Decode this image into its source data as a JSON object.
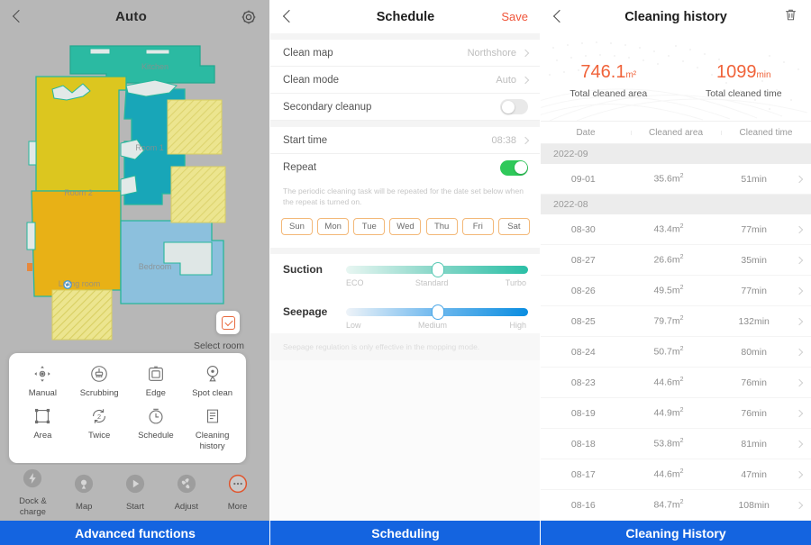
{
  "panel_map": {
    "header": {
      "back_icon": "chevron-left-icon",
      "title": "Auto",
      "settings_icon": "gear-icon"
    },
    "map": {
      "rooms": [
        {
          "name": "Kitchen",
          "color": "#2bbaa2"
        },
        {
          "name": "Room 2",
          "color": "#dcc61f"
        },
        {
          "name": "Room 1",
          "color": "#18a6b8"
        },
        {
          "name": "Living room",
          "color": "#e8b116"
        },
        {
          "name": "Bedroom",
          "color": "#8cc0dd"
        }
      ],
      "select_room_label": "Select room",
      "select_room_icon": "checkbox-checked-icon",
      "grid_icon": "grid-zone-icon"
    },
    "functions": [
      {
        "label": "Manual",
        "icon": "joystick-icon"
      },
      {
        "label": "Scrubbing",
        "icon": "mop-icon"
      },
      {
        "label": "Edge",
        "icon": "edge-clean-icon"
      },
      {
        "label": "Spot clean",
        "icon": "spot-pin-icon"
      },
      {
        "label": "Area",
        "icon": "area-square-icon"
      },
      {
        "label": "Twice",
        "icon": "repeat-twice-icon"
      },
      {
        "label": "Schedule",
        "icon": "clock-icon"
      },
      {
        "label": "Cleaning history",
        "icon": "history-list-icon"
      }
    ],
    "bottom_nav": [
      {
        "label": "Dock & charge",
        "icon": "charge-bolt-icon"
      },
      {
        "label": "Map",
        "icon": "map-pin-icon"
      },
      {
        "label": "Start",
        "icon": "play-icon"
      },
      {
        "label": "Adjust",
        "icon": "fan-icon"
      },
      {
        "label": "More",
        "icon": "more-dots-icon"
      }
    ]
  },
  "panel_schedule": {
    "header": {
      "back_icon": "chevron-left-icon",
      "title": "Schedule",
      "save_label": "Save"
    },
    "rows": [
      {
        "label": "Clean map",
        "value": "Northshore"
      },
      {
        "label": "Clean mode",
        "value": "Auto"
      }
    ],
    "secondary_cleanup": {
      "label": "Secondary cleanup",
      "state": "off"
    },
    "start_time": {
      "label": "Start time",
      "value": "08:38"
    },
    "repeat": {
      "label": "Repeat",
      "state": "on"
    },
    "repeat_hint": "The periodic cleaning task will be repeated for the date set below when the repeat is turned on.",
    "days": [
      "Sun",
      "Mon",
      "Tue",
      "Wed",
      "Thu",
      "Fri",
      "Sat"
    ],
    "suction": {
      "name": "Suction",
      "min": "ECO",
      "mid": "Standard",
      "max": "Turbo",
      "value": "Standard"
    },
    "seepage": {
      "name": "Seepage",
      "min": "Low",
      "mid": "Medium",
      "max": "High",
      "value": "Medium"
    },
    "note": "Seepage regulation is only effective in the mopping mode."
  },
  "panel_history": {
    "header": {
      "back_icon": "chevron-left-icon",
      "title": "Cleaning history",
      "delete_icon": "trash-icon"
    },
    "stats": [
      {
        "value": "746.1",
        "unit": "m²",
        "label": "Total cleaned area"
      },
      {
        "value": "1099",
        "unit": "min",
        "label": "Total cleaned time"
      }
    ],
    "columns": [
      "Date",
      "Cleaned area",
      "Cleaned time"
    ],
    "groups": [
      {
        "month": "2022-09",
        "rows": [
          {
            "date": "09-01",
            "area": "35.6m",
            "time": "51min"
          }
        ]
      },
      {
        "month": "2022-08",
        "rows": [
          {
            "date": "08-30",
            "area": "43.4m",
            "time": "77min"
          },
          {
            "date": "08-27",
            "area": "26.6m",
            "time": "35min"
          },
          {
            "date": "08-26",
            "area": "49.5m",
            "time": "77min"
          },
          {
            "date": "08-25",
            "area": "79.7m",
            "time": "132min"
          },
          {
            "date": "08-24",
            "area": "50.7m",
            "time": "80min"
          },
          {
            "date": "08-23",
            "area": "44.6m",
            "time": "76min"
          },
          {
            "date": "08-19",
            "area": "44.9m",
            "time": "76min"
          },
          {
            "date": "08-18",
            "area": "53.8m",
            "time": "81min"
          },
          {
            "date": "08-17",
            "area": "44.6m",
            "time": "47min"
          },
          {
            "date": "08-16",
            "area": "84.7m",
            "time": "108min"
          }
        ]
      }
    ]
  },
  "captions": {
    "items": [
      "Advanced functions",
      "Scheduling",
      "Cleaning History"
    ],
    "background": "#1464e0"
  }
}
